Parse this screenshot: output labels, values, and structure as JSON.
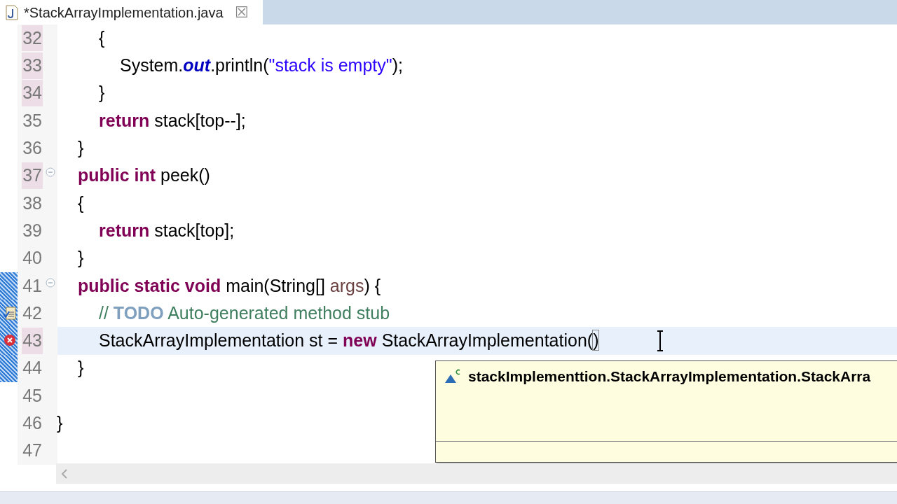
{
  "tab": {
    "title": "*StackArrayImplementation.java",
    "close": "☒",
    "selected": true
  },
  "lines": [
    {
      "number": "32",
      "changed": true,
      "current": false,
      "ruler": false,
      "task": false,
      "error": false,
      "fold": false,
      "tokens": [
        {
          "kind": "plain",
          "text": "\t\t{"
        }
      ]
    },
    {
      "number": "33",
      "changed": true,
      "current": false,
      "ruler": false,
      "task": false,
      "error": false,
      "fold": false,
      "tokens": [
        {
          "kind": "plain",
          "text": "\t\t\tSystem."
        },
        {
          "kind": "field",
          "text": "out"
        },
        {
          "kind": "plain",
          "text": ".println("
        },
        {
          "kind": "string",
          "text": "\"stack is empty\""
        },
        {
          "kind": "plain",
          "text": ");"
        }
      ]
    },
    {
      "number": "34",
      "changed": true,
      "current": false,
      "ruler": false,
      "task": false,
      "error": false,
      "fold": false,
      "tokens": [
        {
          "kind": "plain",
          "text": "\t\t}"
        }
      ]
    },
    {
      "number": "35",
      "changed": false,
      "current": false,
      "ruler": false,
      "task": false,
      "error": false,
      "fold": false,
      "tokens": [
        {
          "kind": "keyword",
          "text": "\t\treturn"
        },
        {
          "kind": "plain",
          "text": " stack[top--];"
        }
      ]
    },
    {
      "number": "36",
      "changed": false,
      "current": false,
      "ruler": false,
      "task": false,
      "error": false,
      "fold": false,
      "tokens": [
        {
          "kind": "plain",
          "text": "\t}"
        }
      ]
    },
    {
      "number": "37",
      "changed": true,
      "current": false,
      "ruler": false,
      "task": false,
      "error": false,
      "fold": true,
      "tokens": [
        {
          "kind": "keyword",
          "text": "\tpublic int"
        },
        {
          "kind": "plain",
          "text": " peek()"
        }
      ]
    },
    {
      "number": "38",
      "changed": false,
      "current": false,
      "ruler": false,
      "task": false,
      "error": false,
      "fold": false,
      "tokens": [
        {
          "kind": "plain",
          "text": "\t{"
        }
      ]
    },
    {
      "number": "39",
      "changed": false,
      "current": false,
      "ruler": false,
      "task": false,
      "error": false,
      "fold": false,
      "tokens": [
        {
          "kind": "keyword",
          "text": "\t\treturn"
        },
        {
          "kind": "plain",
          "text": " stack[top];"
        }
      ]
    },
    {
      "number": "40",
      "changed": false,
      "current": false,
      "ruler": false,
      "task": false,
      "error": false,
      "fold": false,
      "tokens": [
        {
          "kind": "plain",
          "text": "\t}"
        }
      ]
    },
    {
      "number": "41",
      "changed": false,
      "current": false,
      "ruler": true,
      "task": false,
      "error": false,
      "fold": true,
      "tokens": [
        {
          "kind": "keyword",
          "text": "\tpublic static void"
        },
        {
          "kind": "plain",
          "text": " main(String[] "
        },
        {
          "kind": "param",
          "text": "args"
        },
        {
          "kind": "plain",
          "text": ") {"
        }
      ]
    },
    {
      "number": "42",
      "changed": false,
      "current": false,
      "ruler": true,
      "task": true,
      "error": false,
      "fold": false,
      "tokens": [
        {
          "kind": "comment",
          "text": "\t\t// "
        },
        {
          "kind": "todo",
          "text": "TODO"
        },
        {
          "kind": "comment",
          "text": " Auto-generated method stub"
        }
      ]
    },
    {
      "number": "43",
      "changed": true,
      "current": true,
      "ruler": true,
      "task": false,
      "error": true,
      "fold": false,
      "tokens": [
        {
          "kind": "plain",
          "text": "\t\tStackArrayImplementation st = "
        },
        {
          "kind": "keyword",
          "text": "new"
        },
        {
          "kind": "plain",
          "text": " StackArrayImplementation("
        },
        {
          "kind": "bracket",
          "text": ")"
        }
      ]
    },
    {
      "number": "44",
      "changed": false,
      "current": false,
      "ruler": true,
      "task": false,
      "error": false,
      "fold": false,
      "tokens": [
        {
          "kind": "plain",
          "text": "\t}"
        }
      ]
    },
    {
      "number": "45",
      "changed": false,
      "current": false,
      "ruler": false,
      "task": false,
      "error": false,
      "fold": false
    },
    {
      "number": "46",
      "changed": false,
      "current": false,
      "ruler": false,
      "task": false,
      "error": false,
      "fold": false,
      "tokens": [
        {
          "kind": "plain",
          "text": "}"
        }
      ]
    },
    {
      "number": "47",
      "changed": false,
      "current": false,
      "ruler": false,
      "task": false,
      "error": false,
      "fold": false
    }
  ],
  "completion": {
    "items": [
      {
        "text": "stackImplementtion.StackArrayImplementation.StackArra",
        "selected": false
      }
    ]
  }
}
